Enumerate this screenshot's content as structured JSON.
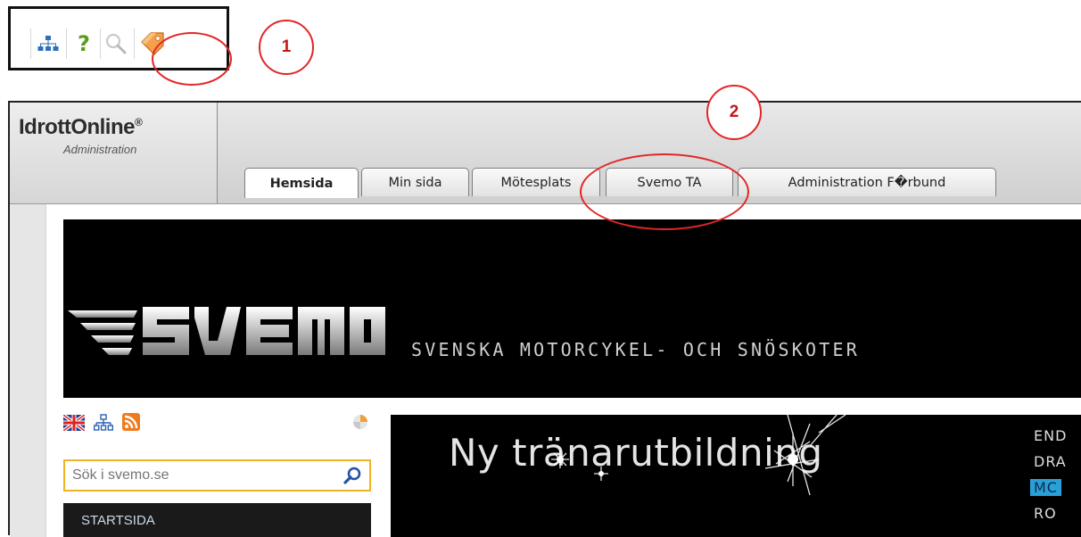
{
  "callouts": {
    "one": "1",
    "two": "2"
  },
  "toolbar": {
    "icons": [
      "sitemap-icon",
      "help-icon",
      "search-icon",
      "bookmark-tag-icon"
    ],
    "help_glyph": "?"
  },
  "idrottonline": {
    "logo": "IdrottOnline",
    "logo_mark": "®",
    "logo_sub": "Administration",
    "tabs": [
      {
        "label": "Hemsida",
        "active": true
      },
      {
        "label": "Min sida",
        "active": false
      },
      {
        "label": "Mötesplats",
        "active": false
      },
      {
        "label": "Svemo TA",
        "active": false
      },
      {
        "label": "Administration F�rbund",
        "active": false
      }
    ]
  },
  "site": {
    "banner_tagline": "SVENSKA MOTORCYKEL- OCH SNÖSKOTER",
    "logo_name": "svemo-logo",
    "search_placeholder": "Sök i svemo.se",
    "menu_start": "STARTSIDA",
    "hero_title": "Ny tränarutbildning",
    "side_menu": [
      {
        "label": "END",
        "selected": false
      },
      {
        "label": "DRA",
        "selected": false
      },
      {
        "label": "MC",
        "selected": true
      },
      {
        "label": "RO",
        "selected": false
      }
    ]
  },
  "colors": {
    "callout": "#e32626",
    "search_border": "#f0b323",
    "side_selected": "#2aa0d8"
  }
}
